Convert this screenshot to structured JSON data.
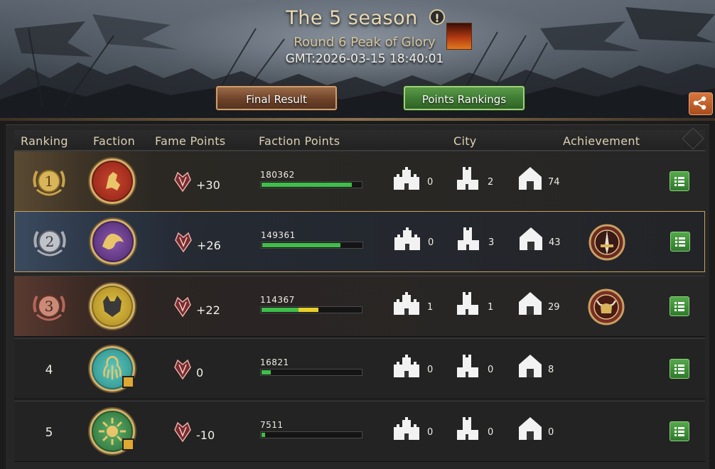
{
  "header": {
    "season_title": "The 5 season",
    "info_icon": "info-icon",
    "round_label": "Round 6 Peak of Glory",
    "gmt_time": "GMT:2026-03-15 18:40:01",
    "final_result_label": "Final Result",
    "points_rankings_label": "Points Rankings",
    "share_icon": "share-icon",
    "colors": {
      "final_button": "#6e4329",
      "points_button": "#3e7a32",
      "share_button": "#c45e28"
    }
  },
  "columns": {
    "ranking": "Ranking",
    "faction": "Faction",
    "fame_points": "Fame Points",
    "faction_points": "Faction Points",
    "city": "City",
    "achievement": "Achievement"
  },
  "rows": [
    {
      "rank": "1",
      "medal": "gold",
      "crest_icon": "lion-crest-icon",
      "crest_color": "#b0301f",
      "fame": "+30",
      "faction_points": "180362",
      "progress": 0.89,
      "bar_color": "#3fbf4a",
      "bar_second_color": "",
      "castle": "0",
      "tower": "2",
      "fort": "74",
      "achievement": "",
      "badge": false
    },
    {
      "rank": "2",
      "medal": "silver",
      "crest_icon": "dragon-crest-icon",
      "crest_color": "#6a3a8a",
      "fame": "+26",
      "faction_points": "149361",
      "progress": 0.77,
      "bar_color": "#3fbf4a",
      "bar_second_color": "",
      "castle": "0",
      "tower": "3",
      "fort": "43",
      "achievement": "sword-medal-icon",
      "badge": false
    },
    {
      "rank": "3",
      "medal": "bronze",
      "crest_icon": "wolf-crest-icon",
      "crest_color": "#c9a52a",
      "fame": "+22",
      "faction_points": "114367",
      "progress": 0.57,
      "bar_color": "#3fbf4a",
      "bar_second_color": "#e8d02a",
      "castle": "1",
      "tower": "1",
      "fort": "29",
      "achievement": "horned-helm-medal-icon",
      "badge": false
    },
    {
      "rank": "4",
      "medal": "",
      "crest_icon": "kraken-crest-icon",
      "crest_color": "#3aa8a0",
      "fame": "0",
      "faction_points": "16821",
      "progress": 0.09,
      "bar_color": "#3fbf4a",
      "bar_second_color": "",
      "castle": "0",
      "tower": "0",
      "fort": "8",
      "achievement": "",
      "badge": true
    },
    {
      "rank": "5",
      "medal": "",
      "crest_icon": "sun-crest-icon",
      "crest_color": "#3a8a4a",
      "fame": "-10",
      "faction_points": "7511",
      "progress": 0.04,
      "bar_color": "#3fbf4a",
      "bar_second_color": "",
      "castle": "0",
      "tower": "0",
      "fort": "0",
      "achievement": "",
      "badge": true
    }
  ]
}
